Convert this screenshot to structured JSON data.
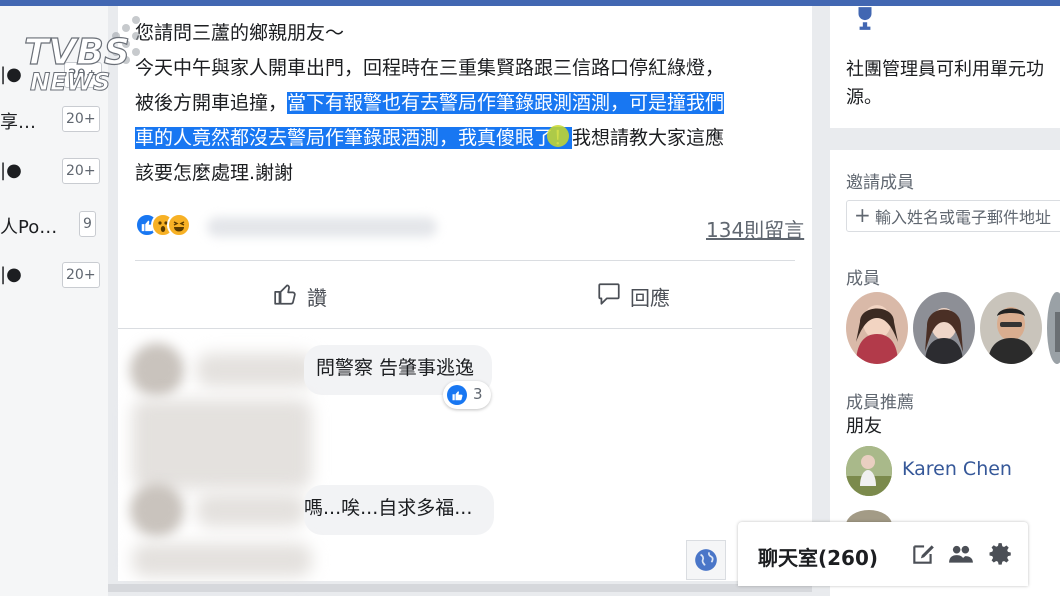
{
  "logo": {
    "text_top": "TVBS",
    "text_bottom": "NEWS"
  },
  "left_sidebar": {
    "rows": [
      {
        "label": "|●",
        "badge": "20+"
      },
      {
        "label": "享…",
        "badge": "20+"
      },
      {
        "label": "|●",
        "badge": "20+"
      },
      {
        "label": "人Po…",
        "badge": "9"
      },
      {
        "label": "|●",
        "badge": "20+"
      }
    ]
  },
  "post": {
    "lines": [
      {
        "plain": "您請問三蘆的鄉親朋友～"
      },
      {
        "plain": "今天中午與家人開車出門，回程時在三重集賢路跟三信路口停紅綠燈，"
      },
      {
        "plain": "被後方開車追撞，",
        "highlight": "當下有報警也有去警局作筆錄跟測酒測，可是撞我們"
      },
      {
        "highlight": "車的人竟然都沒去警局作筆錄跟酒測，我真傻眼了",
        "highlight_tail": "！",
        "plain": "我想請教大家這應"
      },
      {
        "plain": "該要怎麼處理.謝謝"
      }
    ],
    "comments_count": "134則留言",
    "like_label": "讚",
    "comment_label": "回應"
  },
  "comments": [
    {
      "text": "問警察 告肇事逃逸",
      "likes": "3"
    },
    {
      "text": "嗎...唉...自求多福..."
    }
  ],
  "right_column": {
    "admin_text": "社團管理員可利用單元功源。",
    "invite_title": "邀請成員",
    "invite_placeholder": "輸入姓名或電子郵件地址",
    "members_title": "成員",
    "suggest_title": "成員推薦",
    "friends_label": "朋友",
    "suggested_name": "Karen Chen"
  },
  "chat": {
    "title": "聊天室(260)"
  },
  "colors": {
    "brand_blue": "#4267b2",
    "highlight_blue": "#1877f2",
    "link_blue": "#365899"
  }
}
